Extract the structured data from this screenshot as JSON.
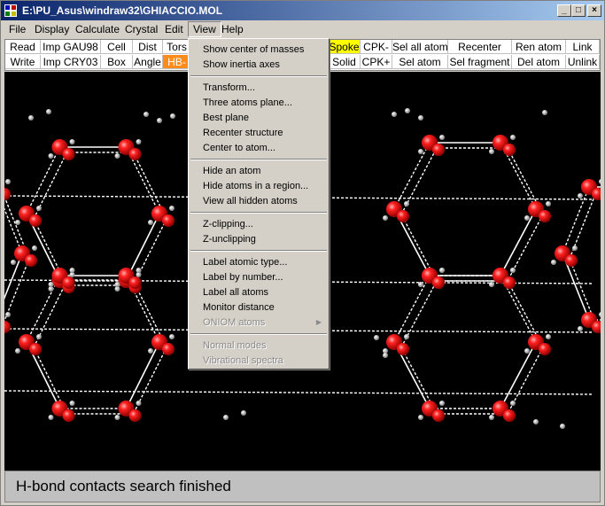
{
  "window": {
    "title": "E:\\PU_Asus\\windraw32\\GHIACCIO.MOL"
  },
  "title_buttons": {
    "minimize": "_",
    "maximize": "□",
    "close": "×"
  },
  "menubar": [
    "File",
    "Display",
    "Calculate",
    "Crystal",
    "Edit",
    "View",
    "Help"
  ],
  "toolbar": {
    "row1": [
      "Read",
      "Imp GAU98",
      "Cell",
      "Dist",
      "Tors",
      "Spoke",
      "CPK-",
      "Sel all atom",
      "Recenter",
      "Ren atom",
      "Link"
    ],
    "row2": [
      "Write",
      "Imp CRY03",
      "Box",
      "Angle",
      "HB-",
      "Solid",
      "CPK+",
      "Sel atom",
      "Sel fragment",
      "Del atom",
      "Unlink"
    ]
  },
  "view_menu": {
    "group1": [
      "Show center of masses",
      "Show inertia axes"
    ],
    "group2": [
      "Transform...",
      "Three atoms plane...",
      "Best plane",
      "Recenter structure",
      "Center to atom..."
    ],
    "group3": [
      "Hide an atom",
      "Hide atoms in a region...",
      "View all hidden atoms"
    ],
    "group4": [
      "Z-clipping...",
      "Z-unclipping"
    ],
    "group5": [
      "Label atomic type...",
      "Label by number...",
      "Label all atoms",
      "Monitor distance",
      "ONIOM atoms"
    ],
    "group6": [
      "Normal modes",
      "Vibrational spectra"
    ]
  },
  "status": {
    "message": "H-bond contacts search finished"
  },
  "colors": {
    "oxygen": "#ff1a1a",
    "hydrogen": "#c8c8c8",
    "background": "#000000",
    "highlight_yellow": "#ffff00",
    "highlight_orange": "#ff8c1a"
  }
}
